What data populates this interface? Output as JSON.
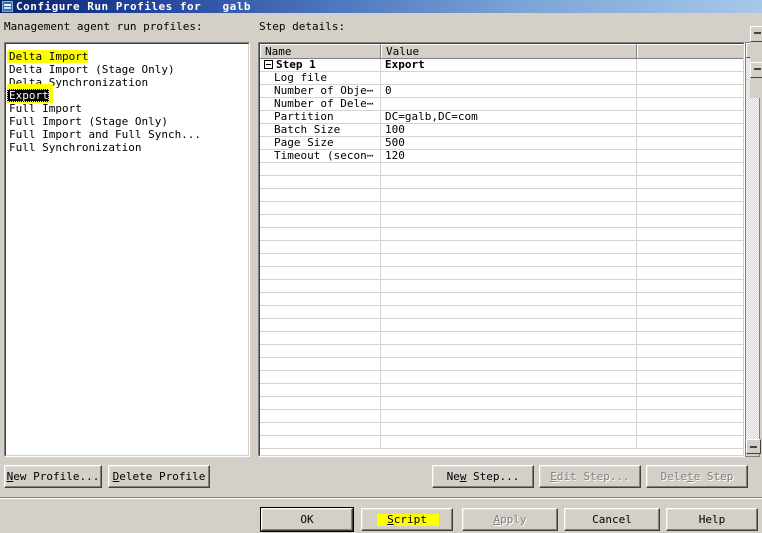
{
  "window": {
    "title": "Configure Run Profiles for   galb",
    "icon": "app-window-icon"
  },
  "labels": {
    "profiles": "Management agent run profiles:",
    "step_details": "Step details:"
  },
  "profiles": {
    "items": [
      {
        "label": "Delta Import",
        "highlighted": true,
        "selected": false
      },
      {
        "label": "Delta Import (Stage Only)",
        "highlighted": false,
        "selected": false
      },
      {
        "label": "Delta Synchronization",
        "highlighted": false,
        "selected": false
      },
      {
        "label": "Export",
        "highlighted": true,
        "selected": true
      },
      {
        "label": "Full Import",
        "highlighted": false,
        "selected": false
      },
      {
        "label": "Full Import (Stage Only)",
        "highlighted": false,
        "selected": false
      },
      {
        "label": "Full Import and Full Synch...",
        "highlighted": false,
        "selected": false
      },
      {
        "label": "Full Synchronization",
        "highlighted": false,
        "selected": false
      }
    ]
  },
  "details": {
    "columns": [
      "Name",
      "Value",
      ""
    ],
    "rows": [
      {
        "name": "Step 1",
        "value": "Export",
        "bold": true,
        "expander": true
      },
      {
        "name": "Log file",
        "value": "",
        "bold": false,
        "expander": false
      },
      {
        "name": "Number of Obje⋯",
        "value": "0",
        "bold": false,
        "expander": false
      },
      {
        "name": "Number of Dele⋯",
        "value": "",
        "bold": false,
        "expander": false
      },
      {
        "name": "Partition",
        "value": "DC=galb,DC=com",
        "bold": false,
        "expander": false
      },
      {
        "name": "Batch Size",
        "value": "100",
        "bold": false,
        "expander": false
      },
      {
        "name": "Page Size",
        "value": "500",
        "bold": false,
        "expander": false
      },
      {
        "name": "Timeout (secon⋯",
        "value": "120",
        "bold": false,
        "expander": false
      }
    ],
    "empty_row_count": 22
  },
  "profile_buttons": [
    {
      "id": "new-profile",
      "label": "New Profile...",
      "accel": "N",
      "disabled": false
    },
    {
      "id": "delete-profile",
      "label": "Delete Profile",
      "accel": "D",
      "disabled": false
    }
  ],
  "step_buttons": [
    {
      "id": "new-step",
      "label": "New Step...",
      "accel": "w",
      "disabled": false
    },
    {
      "id": "edit-step",
      "label": "Edit Step...",
      "accel": "E",
      "disabled": true
    },
    {
      "id": "delete-step",
      "label": "Delete Step",
      "accel": "t",
      "disabled": true
    }
  ],
  "dialog_buttons": [
    {
      "id": "ok",
      "label": "OK",
      "accel": "",
      "disabled": false,
      "default": true,
      "highlighted": false
    },
    {
      "id": "script",
      "label": "Script",
      "accel": "S",
      "disabled": false,
      "default": false,
      "highlighted": true
    },
    {
      "id": "apply",
      "label": "Apply",
      "accel": "A",
      "disabled": true,
      "default": false,
      "highlighted": false
    },
    {
      "id": "cancel",
      "label": "Cancel",
      "accel": "",
      "disabled": false,
      "default": false,
      "highlighted": false
    },
    {
      "id": "help",
      "label": "Help",
      "accel": "",
      "disabled": false,
      "default": false,
      "highlighted": false
    }
  ],
  "colors": {
    "face": "#d4d0c8",
    "highlight_marker": "#ffff00",
    "selection": "#000000",
    "title_start": "#0a246a",
    "title_end": "#a8c8ea"
  },
  "scrollbars": {
    "details_vertical": "scrollbar-vertical",
    "outer_vertical": "scrollbar-vertical-outer"
  }
}
